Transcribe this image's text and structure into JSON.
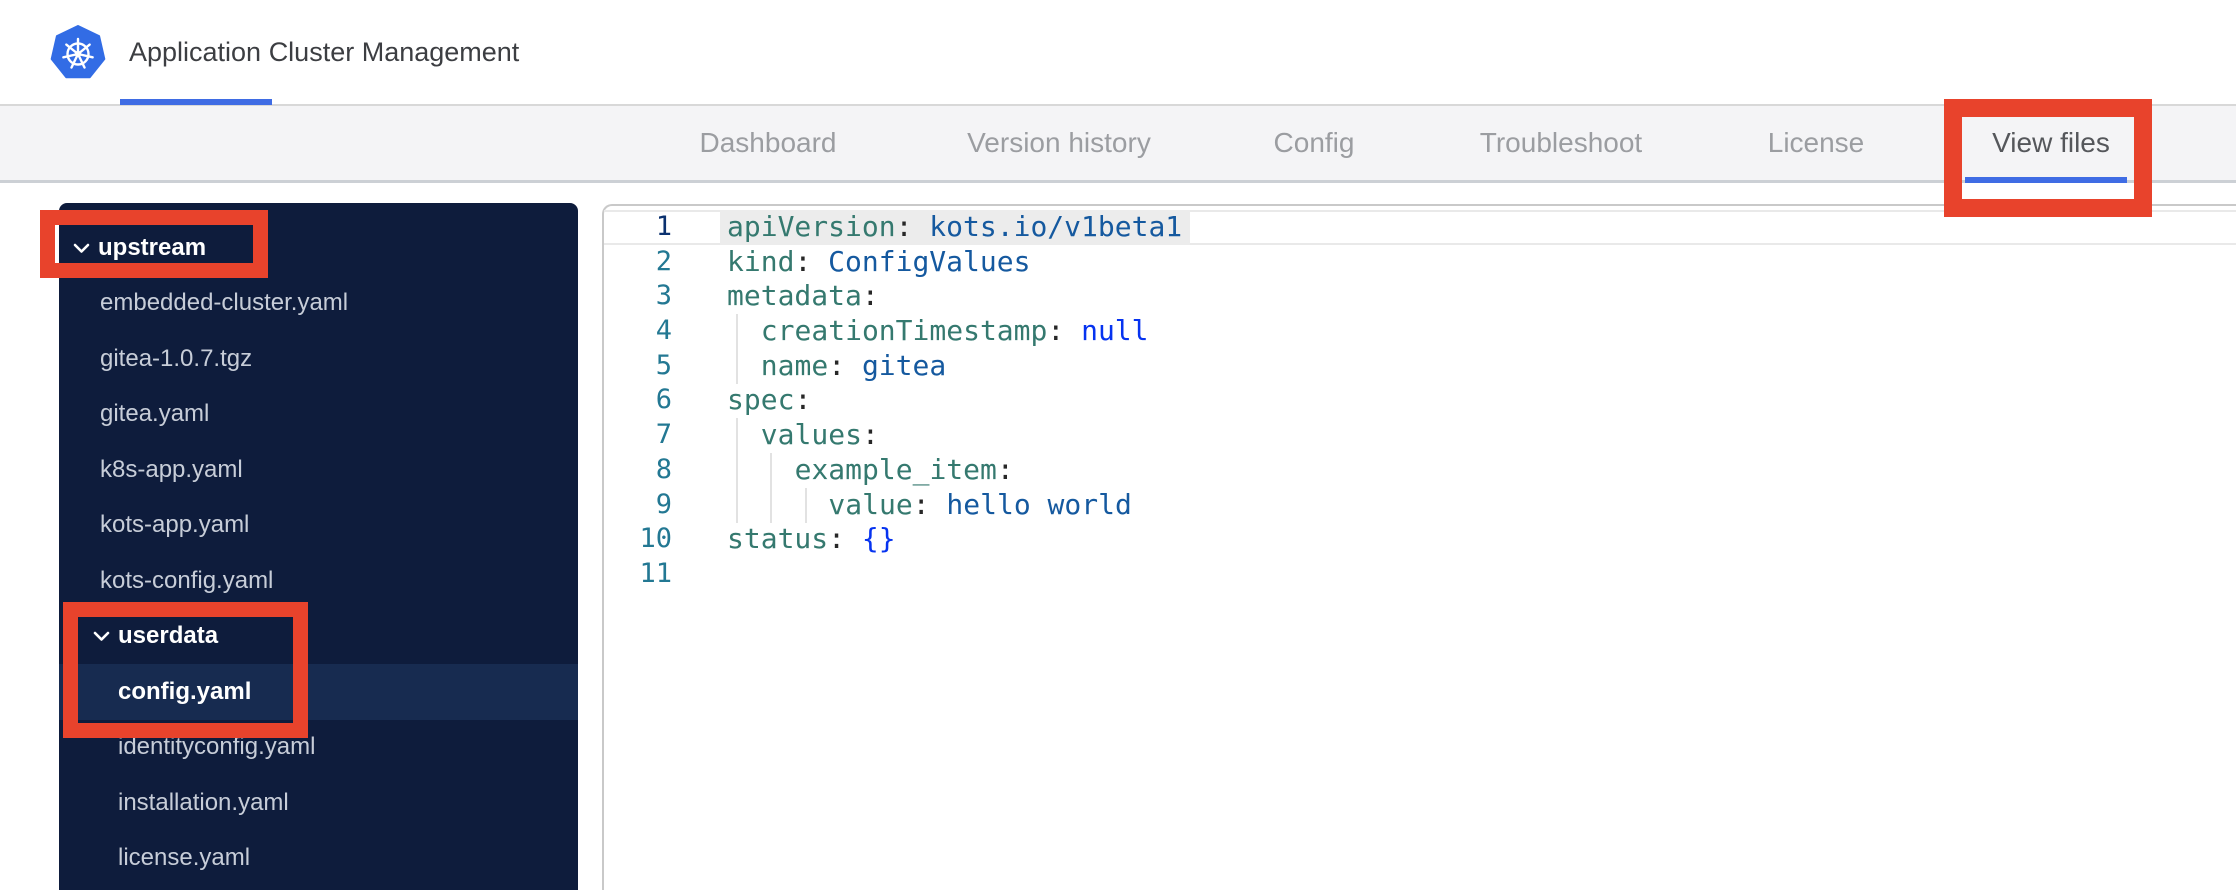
{
  "header": {
    "tabs": [
      {
        "label": "Application",
        "active": true
      },
      {
        "label": "Cluster Management",
        "active": false
      }
    ]
  },
  "nav": {
    "tabs": [
      {
        "label": "Dashboard",
        "active": false
      },
      {
        "label": "Version history",
        "active": false
      },
      {
        "label": "Config",
        "active": false
      },
      {
        "label": "Troubleshoot",
        "active": false
      },
      {
        "label": "License",
        "active": false
      },
      {
        "label": "View files",
        "active": true
      }
    ]
  },
  "sidebar": {
    "items": [
      {
        "label": "upstream",
        "type": "folder",
        "depth": 0,
        "expanded": true,
        "selected": false
      },
      {
        "label": "embedded-cluster.yaml",
        "type": "file",
        "depth": 1,
        "selected": false
      },
      {
        "label": "gitea-1.0.7.tgz",
        "type": "file",
        "depth": 1,
        "selected": false
      },
      {
        "label": "gitea.yaml",
        "type": "file",
        "depth": 1,
        "selected": false
      },
      {
        "label": "k8s-app.yaml",
        "type": "file",
        "depth": 1,
        "selected": false
      },
      {
        "label": "kots-app.yaml",
        "type": "file",
        "depth": 1,
        "selected": false
      },
      {
        "label": "kots-config.yaml",
        "type": "file",
        "depth": 1,
        "selected": false
      },
      {
        "label": "userdata",
        "type": "folder",
        "depth": 1,
        "expanded": true,
        "selected": false
      },
      {
        "label": "config.yaml",
        "type": "file",
        "depth": 2,
        "selected": true
      },
      {
        "label": "identityconfig.yaml",
        "type": "file",
        "depth": 2,
        "selected": false
      },
      {
        "label": "installation.yaml",
        "type": "file",
        "depth": 2,
        "selected": false
      },
      {
        "label": "license.yaml",
        "type": "file",
        "depth": 2,
        "selected": false
      }
    ]
  },
  "editor": {
    "colon": ":",
    "lines": [
      {
        "num": "1",
        "indent": 0,
        "key": "apiVersion",
        "value": "kots.io/v1beta1",
        "value_type": "string",
        "active": true
      },
      {
        "num": "2",
        "indent": 0,
        "key": "kind",
        "value": "ConfigValues",
        "value_type": "string"
      },
      {
        "num": "3",
        "indent": 0,
        "key": "metadata",
        "value": ""
      },
      {
        "num": "4",
        "indent": 1,
        "key": "creationTimestamp",
        "value": "null",
        "value_type": "keyword"
      },
      {
        "num": "5",
        "indent": 1,
        "key": "name",
        "value": "gitea",
        "value_type": "string"
      },
      {
        "num": "6",
        "indent": 0,
        "key": "spec",
        "value": ""
      },
      {
        "num": "7",
        "indent": 1,
        "key": "values",
        "value": ""
      },
      {
        "num": "8",
        "indent": 2,
        "key": "example_item",
        "value": ""
      },
      {
        "num": "9",
        "indent": 3,
        "key": "value",
        "value": "hello world",
        "value_type": "string"
      },
      {
        "num": "10",
        "indent": 0,
        "key": "status",
        "value": "{}",
        "value_type": "keyword"
      },
      {
        "num": "11",
        "indent": 0,
        "key": "",
        "value": ""
      }
    ]
  },
  "icons": {
    "logo": "kubernetes-helm-wheel",
    "folder_chevron": "chevron-down"
  },
  "colors": {
    "kubernetes_blue": "#326ce5",
    "active_tab_underline": "#3f6ce4",
    "annotation_red": "#e8432c",
    "sidebar_bg": "#0e1c3c",
    "sidebar_selected_bg": "#172b50",
    "line_number": "#237893",
    "active_line_number": "#0b316f",
    "yaml_key": "#35796f",
    "yaml_string": "#15599f",
    "yaml_keyword": "#0633f0"
  }
}
